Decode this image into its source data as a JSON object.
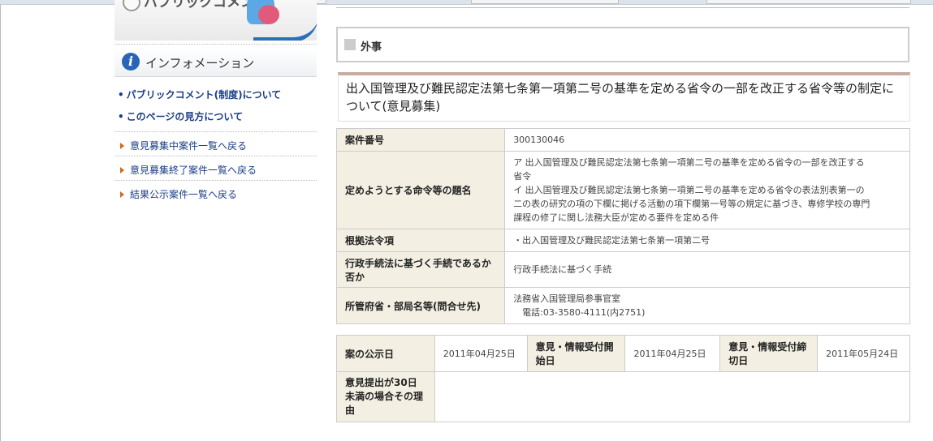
{
  "sidebar": {
    "banner_title": "パブリックコメント",
    "info_heading": "インフォメーション",
    "info_links": [
      {
        "bullet": "•",
        "label": "パブリックコメント(制度)について"
      },
      {
        "bullet": "•",
        "label": "このページの見方について"
      }
    ],
    "nav_links": [
      {
        "label": "意見募集中案件一覧へ戻る"
      },
      {
        "label": "意見募集終了案件一覧へ戻る"
      },
      {
        "label": "結果公示案件一覧へ戻る"
      }
    ]
  },
  "main": {
    "category": "外事",
    "title": "出入国管理及び難民認定法第七条第一項第二号の基準を定める省令の一部を改正する省令等の制定について(意見募集)",
    "details": {
      "case_number_label": "案件番号",
      "case_number": "300130046",
      "ordinance_name_label": "定めようとする命令等の題名",
      "ordinance_name_lines": [
        "ア 出入国管理及び難民認定法第七条第一項第二号の基準を定める省令の一部を改正する",
        "省令",
        "イ 出入国管理及び難民認定法第七条第一項第二号の基準を定める省令の表法別表第一の",
        "二の表の研究の項の下欄に掲げる活動の項下欄第一号等の規定に基づき、専修学校の専門",
        "課程の修了に関し法務大臣が定める要件を定める件"
      ],
      "legal_basis_label": "根拠法令項",
      "legal_basis": "・出入国管理及び難民認定法第七条第一項第二号",
      "procedure_label": "行政手続法に基づく手続であるか否か",
      "procedure": "行政手続法に基づく手続",
      "ministry_label": "所管府省・部局名等(問合せ先)",
      "ministry_lines": [
        "法務省入国管理局参事官室",
        "　電話:03-3580-4111(内2751)"
      ]
    },
    "dates": {
      "announce_label": "案の公示日",
      "announce_date": "2011年04月25日",
      "start_label": "意見・情報受付開始日",
      "start_date": "2011年04月25日",
      "end_label": "意見・情報受付締切日",
      "end_date": "2011年05月24日",
      "reason_label": "意見提出が30日未満の場合その理由",
      "reason": ""
    }
  },
  "colors": {
    "link": "#1b3d87",
    "header_cell": "#f3f0e3",
    "arrow": "#d2691e",
    "accent_border": "#c9aaa0"
  }
}
